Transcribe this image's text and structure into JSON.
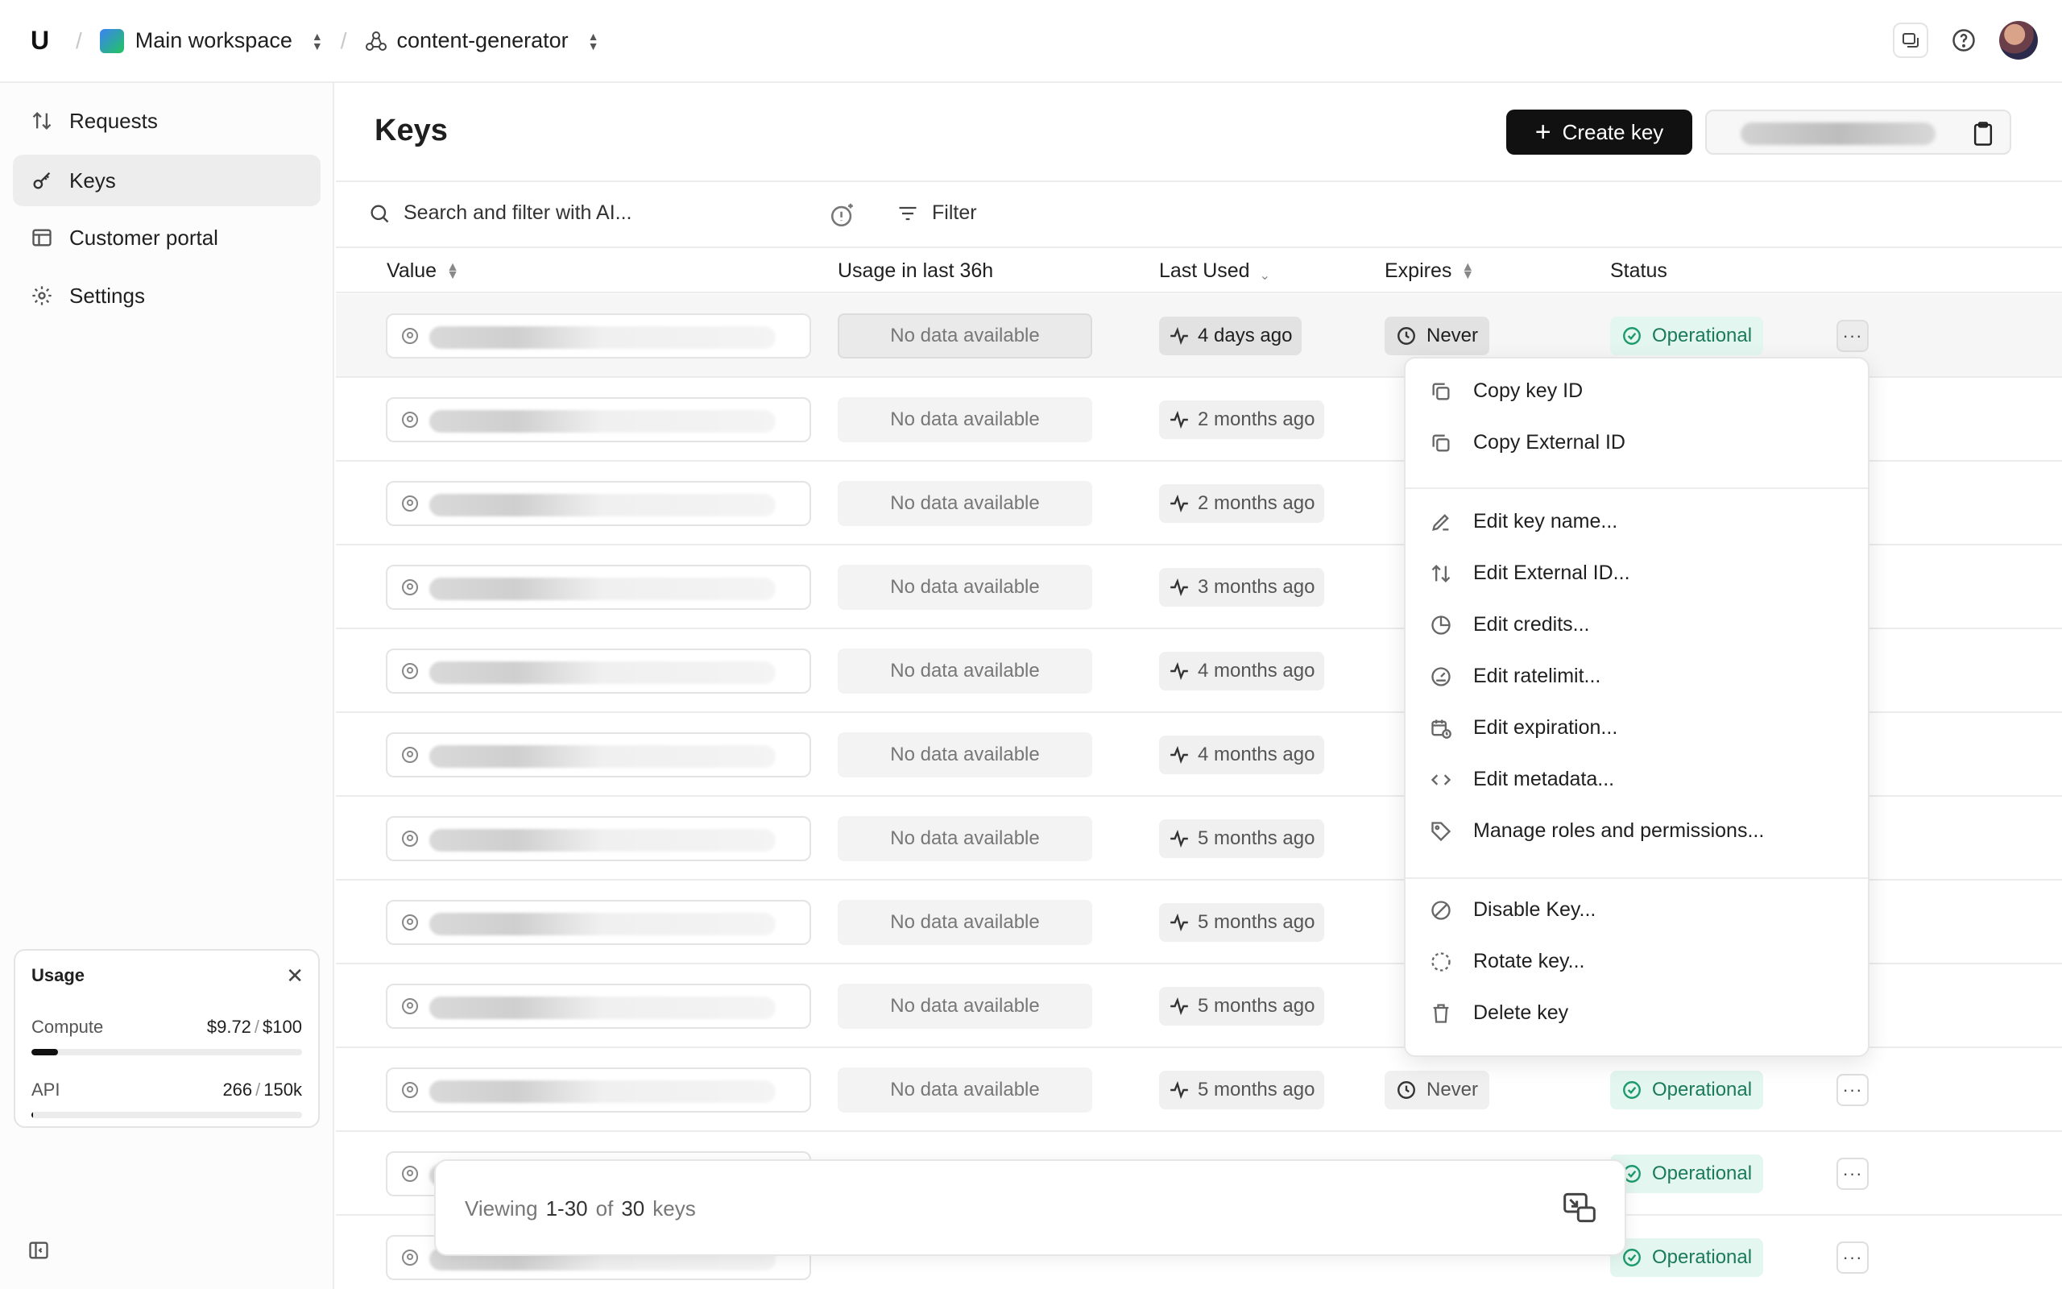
{
  "header": {
    "logo": "U",
    "workspace": "Main workspace",
    "project": "content-generator"
  },
  "sidebar": {
    "items": [
      {
        "label": "Requests",
        "icon": "arrows-updown-icon"
      },
      {
        "label": "Keys",
        "icon": "key-icon"
      },
      {
        "label": "Customer portal",
        "icon": "table-icon"
      },
      {
        "label": "Settings",
        "icon": "gear-icon"
      }
    ],
    "active": "Keys"
  },
  "usage": {
    "title": "Usage",
    "compute_label": "Compute",
    "compute_used": "$9.72",
    "compute_limit": "$100",
    "compute_fraction": 0.0972,
    "api_label": "API",
    "api_used": "266",
    "api_limit": "150k",
    "api_fraction": 0.0018
  },
  "page": {
    "title": "Keys",
    "create_label": "Create key",
    "search_placeholder": "Search and filter with AI...",
    "filter_label": "Filter"
  },
  "table": {
    "headers": [
      "Value",
      "Usage in last 36h",
      "Last Used",
      "Expires",
      "Status"
    ],
    "rows": [
      {
        "usage": "No data available",
        "last_used": "4 days ago",
        "expires": "Never",
        "status": "Operational"
      },
      {
        "usage": "No data available",
        "last_used": "2 months ago"
      },
      {
        "usage": "No data available",
        "last_used": "2 months ago"
      },
      {
        "usage": "No data available",
        "last_used": "3 months ago"
      },
      {
        "usage": "No data available",
        "last_used": "4 months ago"
      },
      {
        "usage": "No data available",
        "last_used": "4 months ago"
      },
      {
        "usage": "No data available",
        "last_used": "5 months ago"
      },
      {
        "usage": "No data available",
        "last_used": "5 months ago"
      },
      {
        "usage": "No data available",
        "last_used": "5 months ago"
      },
      {
        "usage": "No data available",
        "last_used": "5 months ago",
        "expires": "Never",
        "status": "Operational"
      },
      {
        "status": "Operational"
      },
      {
        "status": "Operational"
      }
    ]
  },
  "menu": {
    "items": [
      "Copy key ID",
      "Copy External ID",
      "Edit key name...",
      "Edit External ID...",
      "Edit credits...",
      "Edit ratelimit...",
      "Edit expiration...",
      "Edit metadata...",
      "Manage roles and permissions...",
      "Disable Key...",
      "Rotate key...",
      "Delete key"
    ]
  },
  "footer": {
    "viewing": "Viewing",
    "range": "1-30",
    "of": "of",
    "total": "30",
    "unit": "keys"
  }
}
